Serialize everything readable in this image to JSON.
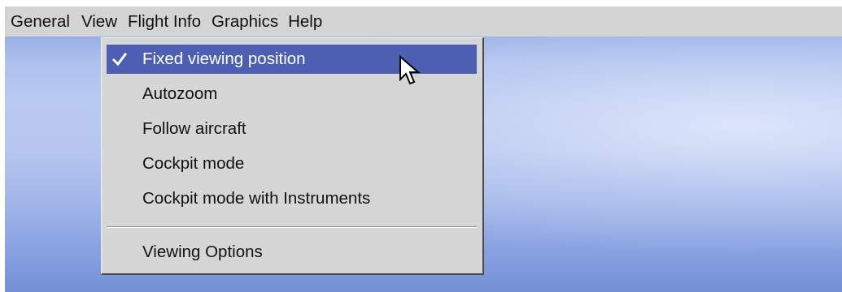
{
  "menubar": {
    "items": [
      {
        "label": "General"
      },
      {
        "label": "View"
      },
      {
        "label": "Flight Info"
      },
      {
        "label": "Graphics"
      },
      {
        "label": "Help"
      }
    ]
  },
  "view_menu": {
    "items": [
      {
        "label": "Fixed viewing position",
        "checked": true,
        "highlighted": true
      },
      {
        "label": "Autozoom",
        "checked": false
      },
      {
        "label": "Follow aircraft",
        "checked": false
      },
      {
        "label": "Cockpit mode",
        "checked": false
      },
      {
        "label": "Cockpit mode with Instruments",
        "checked": false
      }
    ],
    "options_item": {
      "label": "Viewing Options"
    }
  },
  "colors": {
    "menubar_bg": "#d4d4d4",
    "menu_bg": "#d6d6d6",
    "highlight": "#4c5fb3",
    "highlight_text": "#ffffff",
    "sky_top": "#6f8fd6",
    "sky_mid": "#b9c9f0"
  },
  "icons": {
    "checkmark": "checkmark-icon",
    "cursor": "mouse-pointer-icon"
  }
}
